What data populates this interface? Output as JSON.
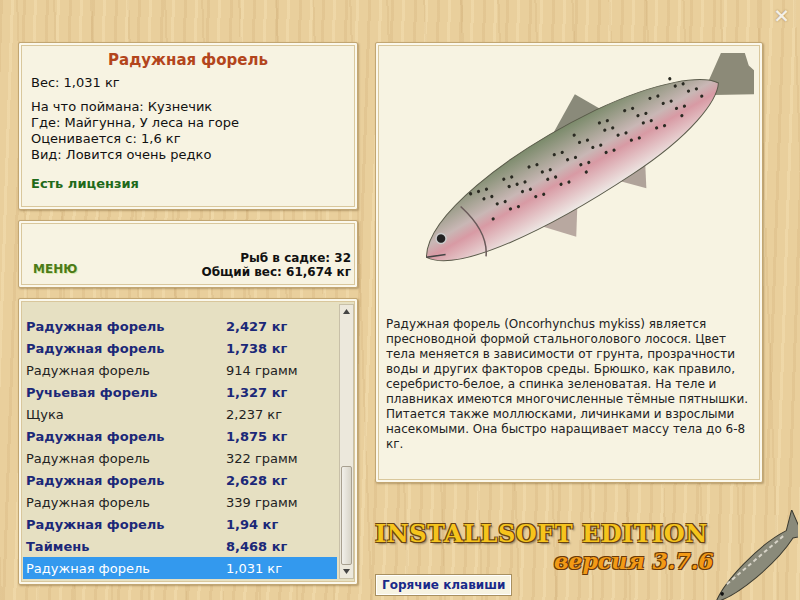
{
  "window": {
    "close": "×"
  },
  "catch": {
    "title": "Радужная форель",
    "weight": "Вес: 1,031 кг",
    "bait": "На что поймана: Кузнечик",
    "place": "Где: Майгунна, У леса на горе",
    "value": "Оценивается с: 1,6 кг",
    "kind": "Вид: Ловится очень редко",
    "license": "Есть лицензия"
  },
  "menu": {
    "label": "МЕНЮ"
  },
  "cage": {
    "count": "Рыб в садке: 32",
    "total": "Общий вес: 61,674 кг"
  },
  "fish_list": [
    {
      "name": "Радужная форель",
      "weight": "2,427 кг",
      "trophy": true,
      "selected": false
    },
    {
      "name": "Радужная форель",
      "weight": "1,738 кг",
      "trophy": true,
      "selected": false
    },
    {
      "name": "Радужная форель",
      "weight": "914 грамм",
      "trophy": false,
      "selected": false
    },
    {
      "name": "Ручьевая форель",
      "weight": "1,327 кг",
      "trophy": true,
      "selected": false
    },
    {
      "name": "Щука",
      "weight": "2,237 кг",
      "trophy": false,
      "selected": false
    },
    {
      "name": "Радужная форель",
      "weight": "1,875 кг",
      "trophy": true,
      "selected": false
    },
    {
      "name": "Радужная форель",
      "weight": "322 грамм",
      "trophy": false,
      "selected": false
    },
    {
      "name": "Радужная форель",
      "weight": "2,628 кг",
      "trophy": true,
      "selected": false
    },
    {
      "name": "Радужная форель",
      "weight": "339 грамм",
      "trophy": false,
      "selected": false
    },
    {
      "name": "Радужная форель",
      "weight": "1,94 кг",
      "trophy": true,
      "selected": false
    },
    {
      "name": "Таймень",
      "weight": "8,468 кг",
      "trophy": true,
      "selected": false
    },
    {
      "name": "Радужная форель",
      "weight": "1,031 кг",
      "trophy": false,
      "selected": true
    }
  ],
  "scrollbar": {
    "level": 1
  },
  "description": "Радужная форель (Oncorhynchus mykiss) является пресноводной формой стальноголового лосося. Цвет тела меняется в зависимости от грунта, прозрачности воды и других факторов среды. Брюшко, как правило, серебристо-белое, а спинка зеленоватая. На теле и плавниках имеются многочисленные тёмные пятнышки. Питается также моллюсками, личинками и взрослыми насекомыми. Она быстро наращивает массу тела до 6-8 кг.",
  "logo": {
    "title": "INSTALLSOFT EDITION",
    "version": "версия 3.7.6"
  },
  "buttons": [
    "Горячие клавиши"
  ]
}
